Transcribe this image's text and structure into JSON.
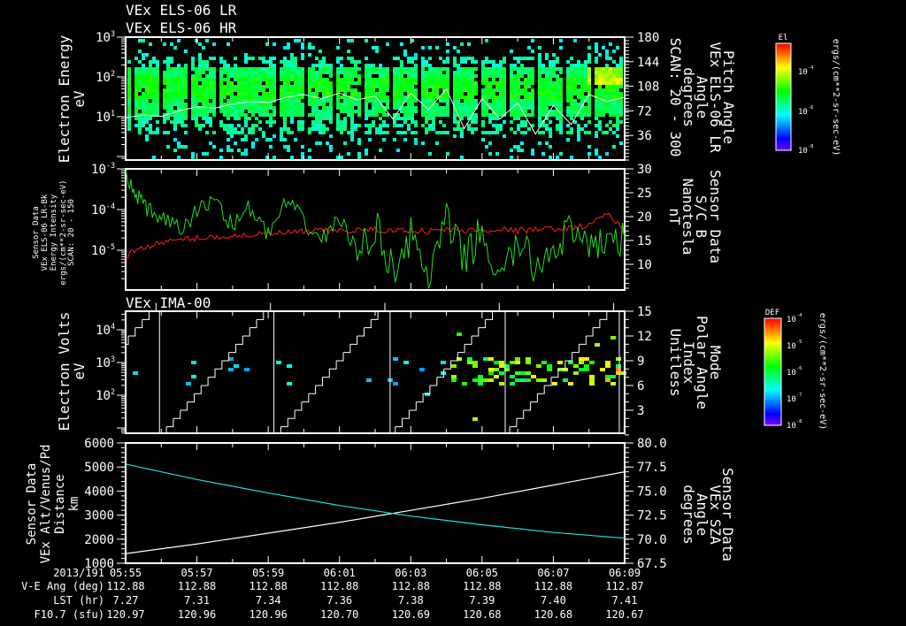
{
  "titles": [
    "VEx ELS-06 LR",
    "VEx ELS-06 HR"
  ],
  "colors": {
    "frame": "#ffffff",
    "red": "#ff2020",
    "green": "#20e020",
    "cyan": "#20e0e0",
    "white": "#ffffff"
  },
  "chart_data": [
    {
      "id": "els-spectrogram",
      "type": "heatmap",
      "ylabel": [
        "Electron Energy",
        "eV"
      ],
      "yscale": "log",
      "ylim": [
        0.8,
        1000
      ],
      "yticks": [
        {
          "base": "10",
          "exp": "3",
          "value": 1000
        },
        {
          "base": "10",
          "exp": "2",
          "value": 100
        },
        {
          "base": "10",
          "exp": "1",
          "value": 10
        }
      ],
      "y2label": [
        "Pitch Angle",
        "VEx ELS-06 LR",
        "Angle",
        "degrees",
        "SCAN: 20 - 300"
      ],
      "y2lim": [
        0,
        180
      ],
      "y2ticks": [
        "180",
        "144",
        "108",
        "72",
        "36"
      ],
      "band": {
        "low_eV": 10,
        "high_eV": 200
      },
      "pitch_angle_line": {
        "t_min": [
          0,
          0.5,
          1,
          1.5,
          2,
          2.5,
          3,
          3.5,
          4,
          4.5,
          5,
          5.5,
          6,
          6.5,
          7,
          7.5,
          8,
          8.5,
          9,
          9.5,
          10,
          10.5,
          11,
          11.5,
          12,
          12.5,
          13,
          13.5,
          14
        ],
        "deg": [
          62,
          66,
          64,
          72,
          78,
          76,
          82,
          86,
          84,
          92,
          96,
          90,
          98,
          88,
          94,
          60,
          98,
          74,
          104,
          46,
          90,
          60,
          84,
          38,
          80,
          52,
          96,
          86,
          92
        ]
      },
      "colorbar": {
        "label": "El",
        "units": "ergs/(cm**2-sr-sec-eV)",
        "ticks": [
          {
            "base": "10",
            "exp": "-4"
          },
          {
            "base": "10",
            "exp": "-6"
          },
          {
            "base": "10",
            "exp": "-8"
          }
        ],
        "range_exp": [
          -9,
          -3
        ]
      }
    },
    {
      "id": "energy-intensity-and-b",
      "type": "line",
      "ylabel": [
        "Sensor Data",
        "VEx ELS-06 LR-Bk",
        "Energy Intensity",
        "ergs/(cm**2-sr-sec-eV)",
        "SCAN: 20 - 150"
      ],
      "yscale": "log",
      "ylim": [
        1.05e-06,
        0.001
      ],
      "yticks": [
        {
          "base": "10",
          "exp": "-3"
        },
        {
          "base": "10",
          "exp": "-4"
        },
        {
          "base": "10",
          "exp": "-5"
        }
      ],
      "y2label": [
        "Sensor Data",
        "S/C B",
        "Nanotesla",
        "nT"
      ],
      "y2lim": [
        4.6,
        30
      ],
      "y2ticks": [
        "30",
        "25",
        "20",
        "15",
        "10"
      ],
      "series": [
        {
          "name": "Energy Intensity",
          "color": "red",
          "axis": "left",
          "t_min": [
            0,
            0.5,
            1,
            1.5,
            2,
            2.5,
            3,
            3.5,
            4,
            4.5,
            5,
            5.5,
            6,
            6.5,
            7,
            7.5,
            8,
            8.5,
            9,
            9.5,
            10,
            10.5,
            11,
            11.5,
            12,
            12.5,
            13,
            13.5,
            14
          ],
          "values": [
            7e-06,
            1.2e-05,
            1.5e-05,
            1.8e-05,
            2e-05,
            2.1e-05,
            2.2e-05,
            2.4e-05,
            2.5e-05,
            2.7e-05,
            2.8e-05,
            3e-05,
            3e-05,
            3.1e-05,
            3.2e-05,
            3e-05,
            3.1e-05,
            3e-05,
            3.2e-05,
            3e-05,
            3.1e-05,
            3.3e-05,
            3e-05,
            3.2e-05,
            3.4e-05,
            3.6e-05,
            4e-05,
            8e-05,
            2.2e-05
          ]
        },
        {
          "name": "S/C B",
          "color": "green",
          "axis": "right",
          "t_min": [
            0,
            0.3,
            0.6,
            1,
            1.5,
            2,
            2.5,
            3,
            3.5,
            4,
            4.5,
            5,
            5.5,
            6,
            6.5,
            7,
            7.5,
            8,
            8.5,
            9,
            9.5,
            10,
            10.5,
            11,
            11.5,
            12,
            12.5,
            13,
            13.5,
            14
          ],
          "values": [
            28,
            25,
            21,
            20,
            17,
            21,
            24,
            18,
            22,
            16,
            23,
            19,
            15,
            20,
            12,
            18,
            9,
            16,
            7,
            19,
            11,
            17,
            6,
            15,
            9,
            14,
            17,
            12,
            16,
            15
          ]
        }
      ]
    },
    {
      "id": "ima-spectrogram",
      "type": "heatmap",
      "title": "VEx IMA-00",
      "ylabel": [
        "Electron Volts",
        "eV"
      ],
      "yscale": "log",
      "yticks": [
        {
          "base": "10",
          "exp": "4"
        },
        {
          "base": "10",
          "exp": "3"
        },
        {
          "base": "10",
          "exp": "2"
        }
      ],
      "y2label": [
        "Mode",
        "Polar Angle",
        "Index",
        "Unitless"
      ],
      "y2lim": [
        0,
        15
      ],
      "y2ticks": [
        "15",
        "12",
        "9",
        "6",
        "3"
      ],
      "polar_index_resets_min": [
        0.95,
        4.16,
        7.42,
        10.65,
        13.85
      ],
      "colorbar": {
        "label": "DEF",
        "units": "ergs/(cm**2-sr-sec-eV)",
        "ticks": [
          {
            "base": "10",
            "exp": "-4"
          },
          {
            "base": "10",
            "exp": "-5"
          },
          {
            "base": "10",
            "exp": "-6"
          },
          {
            "base": "10",
            "exp": "-7"
          },
          {
            "base": "10",
            "exp": "-8"
          }
        ],
        "range_exp": [
          -8,
          -4
        ]
      }
    },
    {
      "id": "altitude-and-sza",
      "type": "line",
      "ylabel": [
        "Sensor Data",
        "VEx Alt/Venus/Pd",
        "Distance",
        "km"
      ],
      "ylim": [
        1000,
        6000
      ],
      "yticks": [
        "6000",
        "5000",
        "4000",
        "3000",
        "2000",
        "1000"
      ],
      "y2label": [
        "Sensor Data",
        "VEx SZA",
        "Angle",
        "degrees"
      ],
      "y2lim": [
        67.5,
        80.0
      ],
      "y2ticks": [
        "80.0",
        "77.5",
        "75.0",
        "72.5",
        "70.0",
        "67.5"
      ],
      "series": [
        {
          "name": "Distance",
          "color": "white",
          "axis": "left",
          "t_min": [
            0,
            2,
            4,
            6,
            8,
            10,
            12,
            14
          ],
          "values": [
            1400,
            1800,
            2250,
            2700,
            3200,
            3700,
            4250,
            4800
          ]
        },
        {
          "name": "SZA",
          "color": "cyan",
          "axis": "right",
          "t_min": [
            0,
            2,
            4,
            6,
            8,
            10,
            12,
            14
          ],
          "values": [
            77.8,
            76.2,
            74.8,
            73.5,
            72.4,
            71.5,
            70.7,
            70.1
          ]
        }
      ]
    }
  ],
  "footer": {
    "row_labels": [
      "2013/191",
      "V-E Ang (deg)",
      "LST (hr)",
      "F10.7 (sfu)"
    ],
    "times": [
      "05:55",
      "05:57",
      "05:59",
      "06:01",
      "06:03",
      "06:05",
      "06:07",
      "06:09"
    ],
    "ve_ang": [
      "112.88",
      "112.88",
      "112.88",
      "112.88",
      "112.88",
      "112.88",
      "112.88",
      "112.87"
    ],
    "lst": [
      "7.27",
      "7.31",
      "7.34",
      "7.36",
      "7.38",
      "7.39",
      "7.40",
      "7.41"
    ],
    "f107": [
      "120.97",
      "120.96",
      "120.96",
      "120.70",
      "120.69",
      "120.68",
      "120.68",
      "120.67"
    ]
  }
}
